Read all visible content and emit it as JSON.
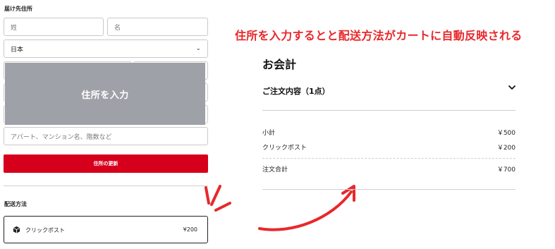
{
  "shipping_address": {
    "section_label": "届け先住所",
    "last_name_placeholder": "姓",
    "first_name_placeholder": "名",
    "country_value": "日本",
    "apartment_placeholder": "アパート、マンション名、階数など",
    "overlay_label": "住所を入力",
    "update_button_label": "住所の更新"
  },
  "shipping_method": {
    "section_label": "配送方法",
    "option_name": "クリックポスト",
    "option_price": "¥200"
  },
  "annotation": {
    "headline": "住所を入力するとと配送方法がカートに自動反映される",
    "accent_color": "#e8282b"
  },
  "checkout": {
    "title": "お会計",
    "order_summary_label": "ご注文内容（1点）",
    "subtotal_label": "小計",
    "subtotal_value": "￥500",
    "shipping_label": "クリックポスト",
    "shipping_value": "￥200",
    "total_label": "注文合計",
    "total_value": "￥700"
  },
  "colors": {
    "primary_red": "#d6001c",
    "overlay_gray": "#9fa1a8"
  }
}
